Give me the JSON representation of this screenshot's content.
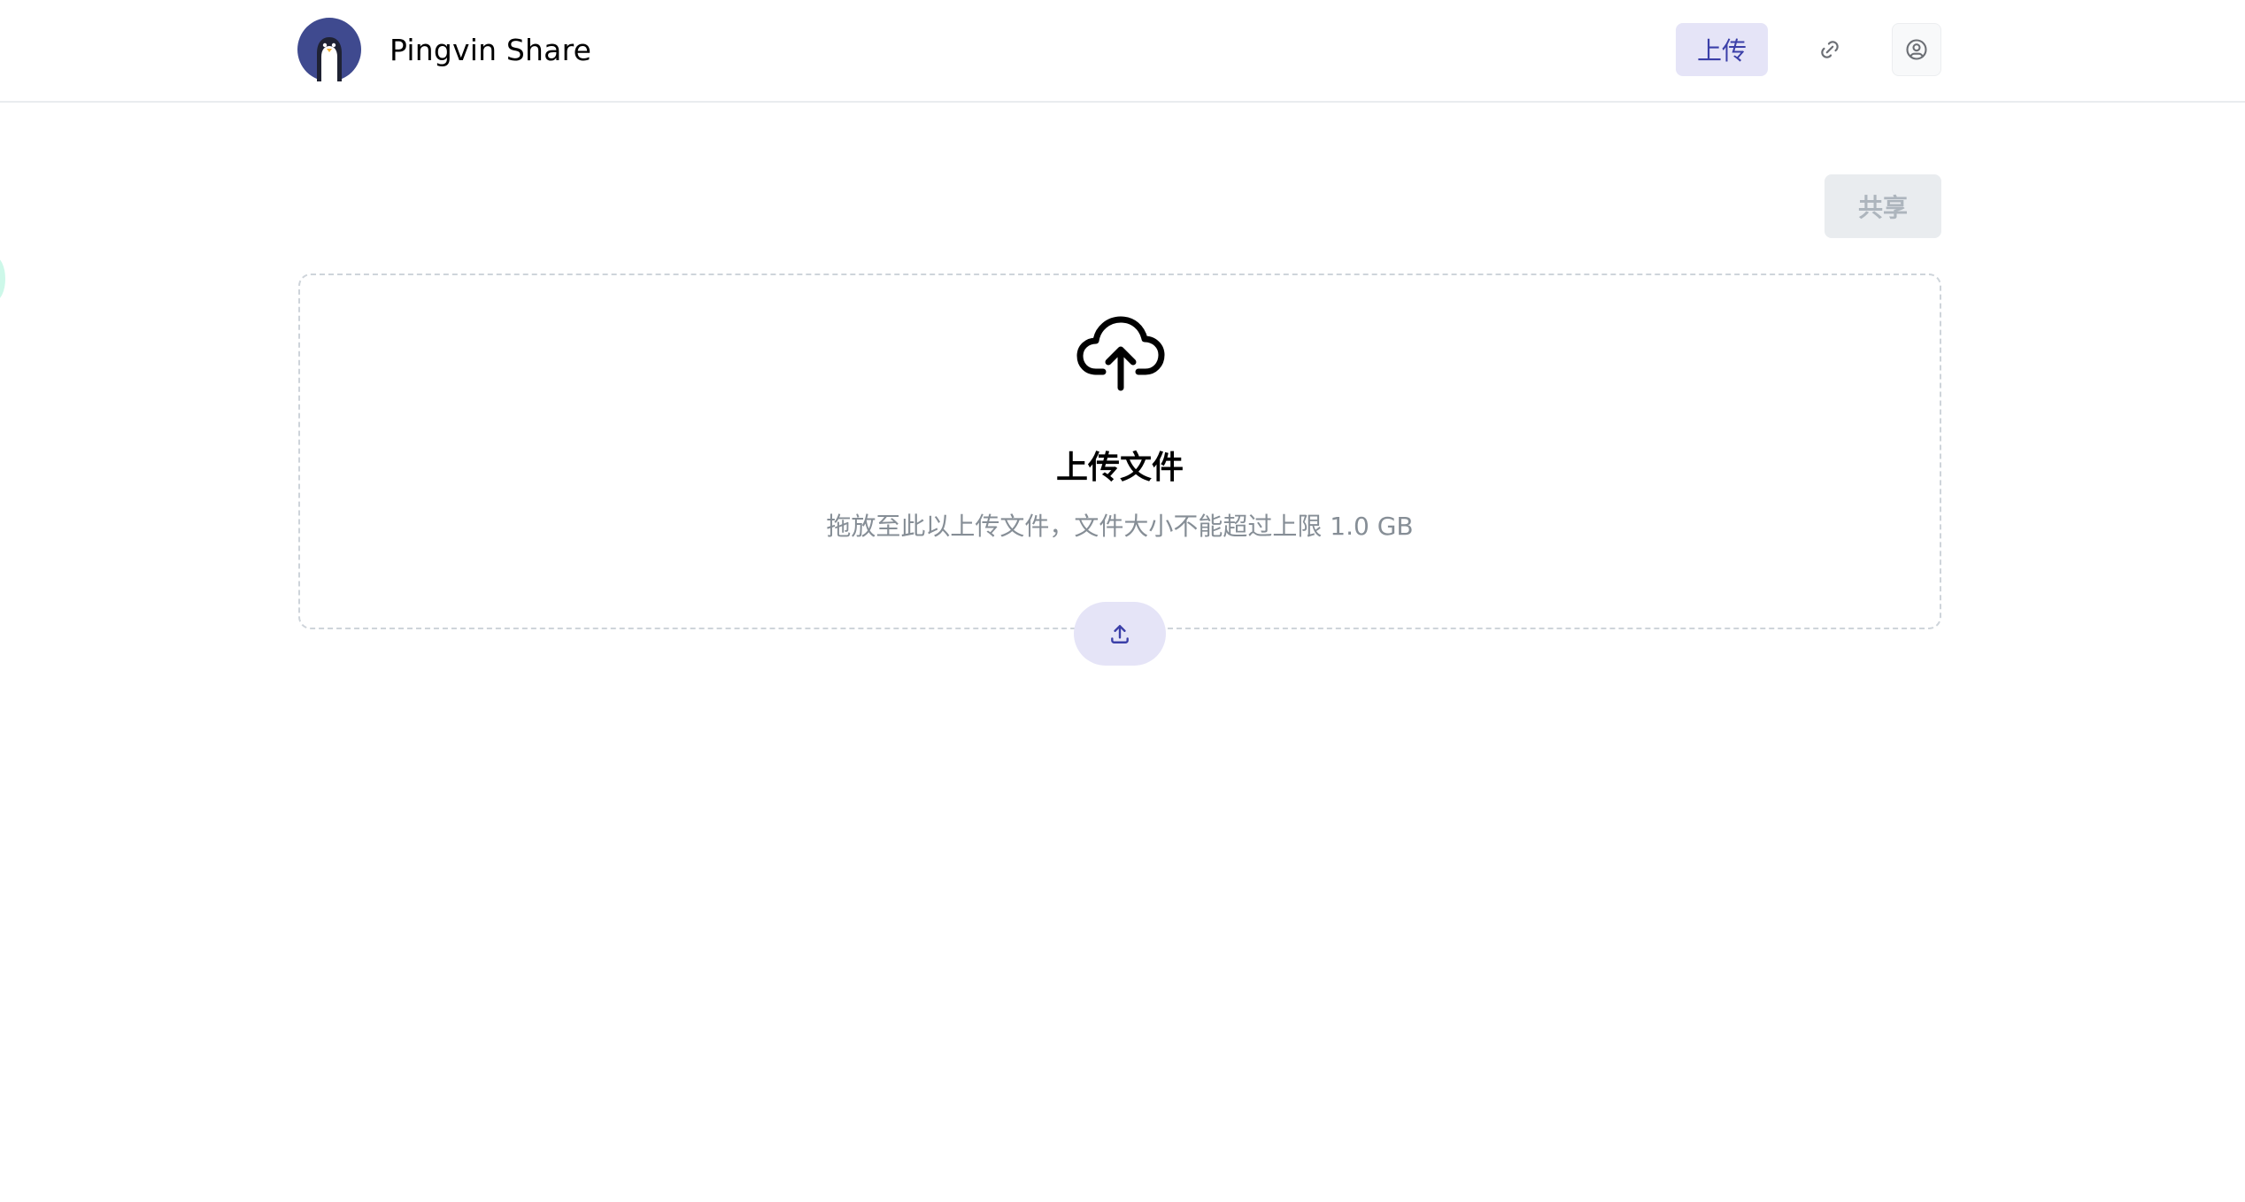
{
  "header": {
    "app_title": "Pingvin Share",
    "nav": {
      "upload_label": "上传",
      "link_icon": "link-icon",
      "user_icon": "user-circle-icon"
    }
  },
  "toolbar": {
    "share_label": "共享"
  },
  "dropzone": {
    "icon": "cloud-upload-icon",
    "title": "上传文件",
    "subtitle": "拖放至此以上传文件，文件大小不能超过上限 1.0 GB",
    "upload_button_icon": "upload-icon"
  },
  "colors": {
    "accent": "#3b3fa8",
    "accent_light": "#e5e4f7",
    "logo_bg": "#3f4a8f",
    "muted_text": "#868e96",
    "disabled_bg": "#e9ecef",
    "disabled_text": "#adb5bd"
  }
}
